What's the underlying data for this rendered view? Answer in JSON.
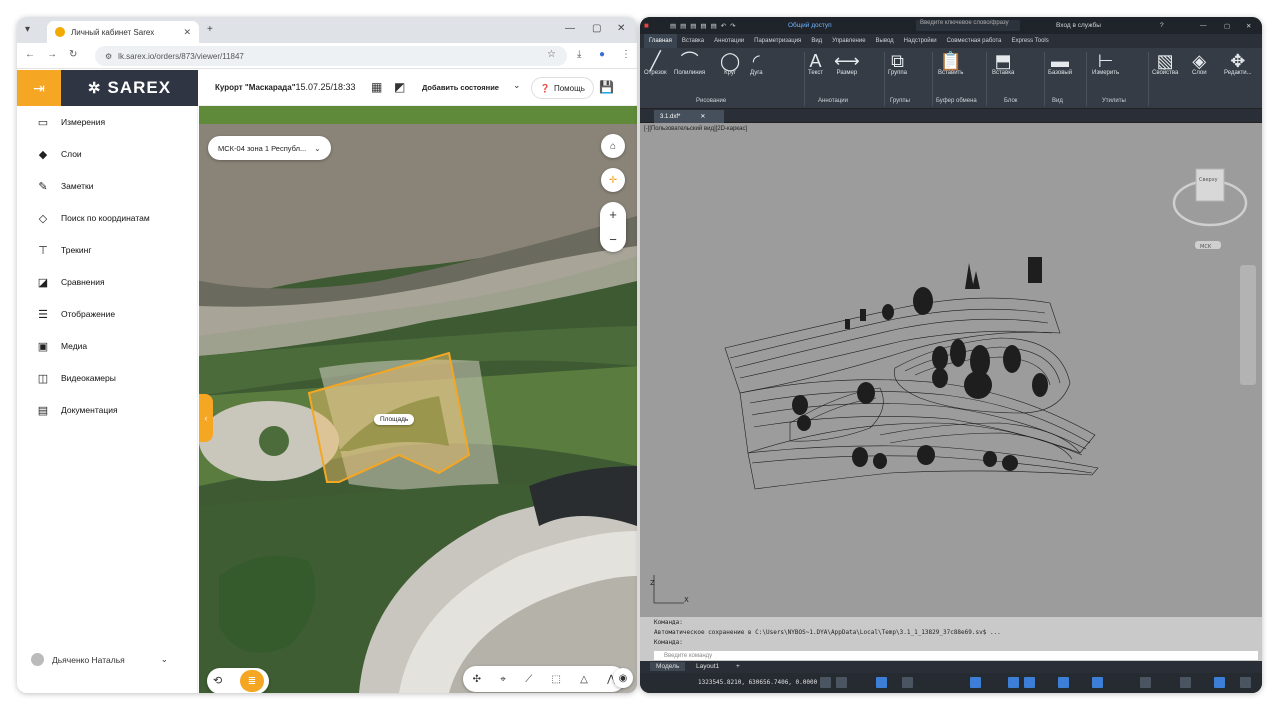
{
  "browser": {
    "tab_title": "Личный кабинет Sarex",
    "url": "lk.sarex.io/orders/873/viewer/11847"
  },
  "app": {
    "logo_text": "SAREX",
    "object_label": "Курорт \"Маскарада\"",
    "object_date": "15.07.25/18:33",
    "add_state_label": "Добавить состояние",
    "help_label": "Помощь",
    "accent": "#f5a623",
    "logo_bg": "#2f3542"
  },
  "sidebar": {
    "items": [
      {
        "label": "Измерения",
        "icon": "ruler-icon"
      },
      {
        "label": "Слои",
        "icon": "layers-icon"
      },
      {
        "label": "Заметки",
        "icon": "pencil-icon"
      },
      {
        "label": "Поиск по координатам",
        "icon": "diamond-icon"
      },
      {
        "label": "Трекинг",
        "icon": "tracking-icon"
      },
      {
        "label": "Сравнения",
        "icon": "compare-icon"
      },
      {
        "label": "Отображение",
        "icon": "sliders-icon"
      },
      {
        "label": "Медиа",
        "icon": "media-icon"
      },
      {
        "label": "Видеокамеры",
        "icon": "camera-icon"
      },
      {
        "label": "Документация",
        "icon": "document-icon"
      }
    ],
    "user_name": "Дьяченко Наталья"
  },
  "map": {
    "crs_label": "МСК-04 зона 1 Республ...",
    "polygon_label": "Площадь"
  },
  "cad": {
    "title_search": "Введите ключевое слово/фразу",
    "title_share": "Общий доступ",
    "title_signin": "Вход в службы",
    "ribbon_tabs": [
      "Главная",
      "Вставка",
      "Аннотации",
      "Параметризация",
      "Вид",
      "Управление",
      "Вывод",
      "Надстройки",
      "Совместная работа",
      "Express Tools"
    ],
    "tools": {
      "line": "Отрезок",
      "polyline": "Полилиния",
      "circle": "Круг",
      "arc": "Дуга",
      "text": "Текст",
      "dimension": "Размер",
      "group": "Группа",
      "paste": "Вставить",
      "insert": "Вставка",
      "base": "Базовый",
      "measure": "Измерить",
      "properties": "Свойства",
      "layers": "Слои",
      "modify": "Редакти..."
    },
    "groups": {
      "draw": "Рисование",
      "annotation": "Аннотации",
      "groups": "Группы",
      "clipboard": "Буфер обмена",
      "block": "Блок",
      "view": "Вид",
      "utilities": "Утилиты"
    },
    "doc_tab": "3.1.dxf*",
    "viewport_label": "[-][Пользовательский вид][2D-каркас]",
    "cmd_line1": "Команда:",
    "cmd_line2": "Автоматическое сохранение в C:\\Users\\NYBOS~1.DYA\\AppData\\Local\\Temp\\3.1_1_13829_37c88e69.sv$ ...",
    "cmd_line3": "Команда:",
    "cmd_placeholder": "Введите команду",
    "layout_tabs": [
      "Модель",
      "Layout1"
    ],
    "coords": "1323545.8210, 630656.7406, 0.0000",
    "viewcube_top": "Сверху",
    "wcs": "МСК"
  }
}
